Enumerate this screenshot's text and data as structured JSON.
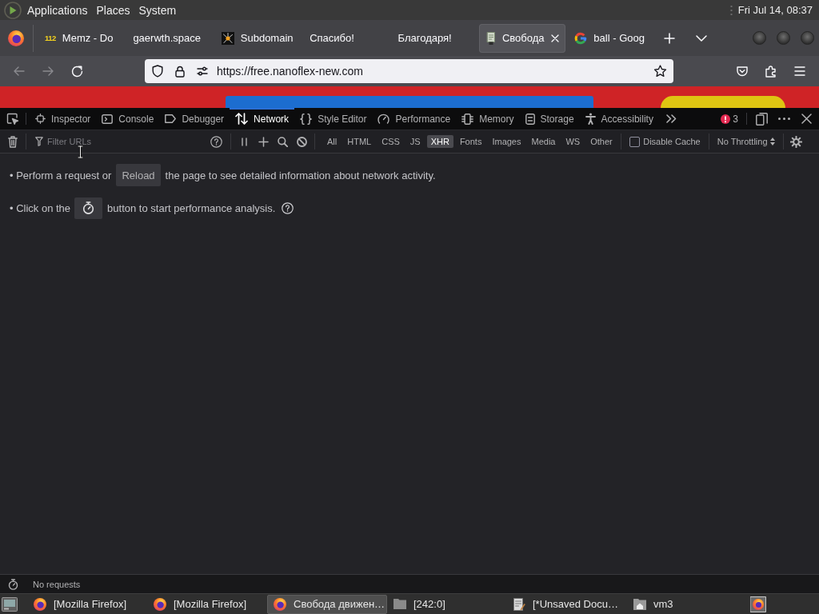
{
  "top_panel": {
    "menus": [
      "Applications",
      "Places",
      "System"
    ],
    "clock": "Fri Jul 14, 08:37"
  },
  "browser_tabs": [
    {
      "title": "Memz - Do",
      "favicon_text": "112",
      "selected": false
    },
    {
      "title": "gaerwth.space",
      "selected": false
    },
    {
      "title": "Subdomain",
      "selected": false
    },
    {
      "title": "Спасибо!",
      "selected": false
    },
    {
      "title": "Благодаря!",
      "selected": false
    },
    {
      "title": "Свобода",
      "selected": true
    },
    {
      "title": "ball - Goog",
      "selected": false
    }
  ],
  "navigation": {
    "back": {
      "disabled": true
    },
    "forward": {
      "disabled": true
    },
    "url": "https://free.nanoflex-new.com"
  },
  "devtools": {
    "tabs": [
      {
        "label": "Inspector",
        "selected": false
      },
      {
        "label": "Console",
        "selected": false
      },
      {
        "label": "Debugger",
        "selected": false
      },
      {
        "label": "Network",
        "selected": true
      },
      {
        "label": "Style Editor",
        "selected": false
      },
      {
        "label": "Performance",
        "selected": false
      },
      {
        "label": "Memory",
        "selected": false
      },
      {
        "label": "Storage",
        "selected": false
      },
      {
        "label": "Accessibility",
        "selected": false
      }
    ],
    "error_count": "3",
    "network_toolbar": {
      "filter": {
        "placeholder": "Filter URLs"
      },
      "type_filters": [
        {
          "label": "All",
          "selected": false
        },
        {
          "label": "HTML",
          "selected": false
        },
        {
          "label": "CSS",
          "selected": false
        },
        {
          "label": "JS",
          "selected": false
        },
        {
          "label": "XHR",
          "selected": true
        },
        {
          "label": "Fonts",
          "selected": false
        },
        {
          "label": "Images",
          "selected": false
        },
        {
          "label": "Media",
          "selected": false
        },
        {
          "label": "WS",
          "selected": false
        },
        {
          "label": "Other",
          "selected": false
        }
      ],
      "disable_cache": {
        "label": "Disable Cache",
        "checked": false
      },
      "throttling": "No Throttling"
    },
    "empty_state": [
      {
        "kind": "reload",
        "before": "• Perform a request or",
        "button": "Reload",
        "after": "the page to see detailed information about network activity."
      },
      {
        "kind": "performance",
        "before": "• Click on the",
        "after": "button to start performance analysis."
      }
    ],
    "status_bar": {
      "text": "No requests"
    }
  },
  "taskbar": {
    "items": [
      {
        "label": "[Mozilla Firefox]",
        "selected": false
      },
      {
        "label": "[Mozilla Firefox]",
        "selected": false
      },
      {
        "label": "Свобода движен…",
        "selected": true
      },
      {
        "label": "[242:0]",
        "selected": false
      },
      {
        "label": "[*Unsaved Docu…",
        "selected": false
      },
      {
        "label": "vm3",
        "selected": false
      }
    ]
  }
}
